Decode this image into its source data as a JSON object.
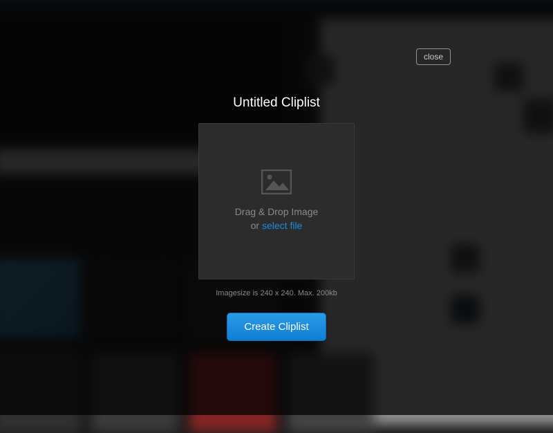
{
  "modal": {
    "close_label": "close",
    "title": "Untitled Cliplist",
    "dropzone": {
      "line1": "Drag & Drop Image",
      "or": "or ",
      "select_file": "select file"
    },
    "hint": "Imagesize is 240 x  240. Max. 200kb",
    "create_label": "Create Cliplist"
  },
  "colors": {
    "accent": "#1b8cdc"
  }
}
